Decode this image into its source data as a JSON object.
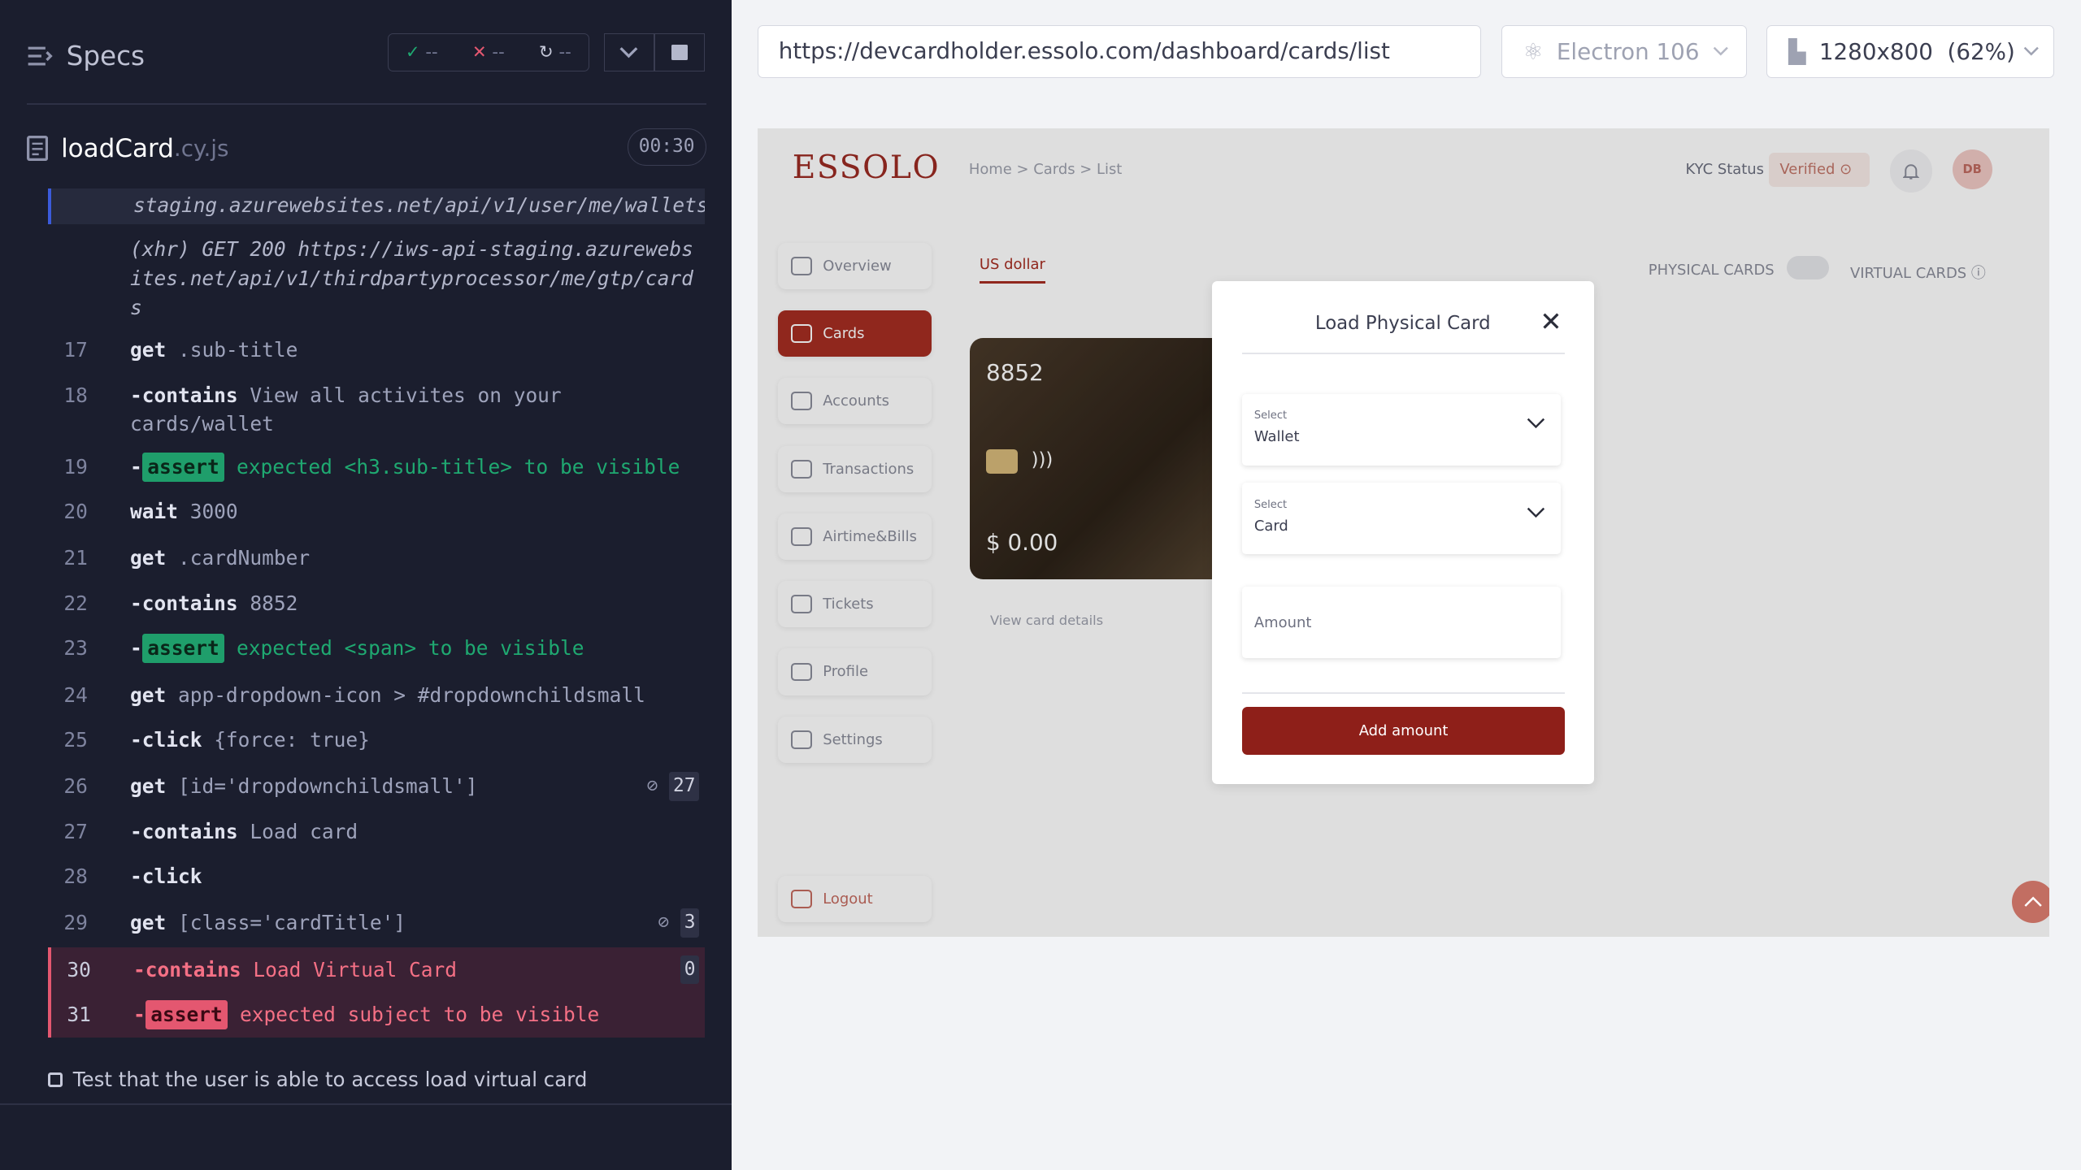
{
  "runner": {
    "specs_title": "Specs",
    "stats": {
      "passed": "--",
      "failed": "--",
      "pending": "--"
    },
    "file_name": "loadCard",
    "file_ext": ".cy.js",
    "timer": "00:30",
    "commands": [
      {
        "num": "",
        "text": "staging.azurewebsites.net/api/v1/user/me/wallets"
      },
      {
        "num": "",
        "text": "(xhr) GET 200 https://iws-api-staging.azurewebsites.net/api/v1/thirdpartyprocessor/me/gtp/cards"
      },
      {
        "num": "17",
        "name": "get",
        "arg": ".sub-title"
      },
      {
        "num": "18",
        "name": "-contains",
        "arg": "View all activites on your cards/wallet"
      },
      {
        "num": "19",
        "name": "assert",
        "arg": "expected <h3.sub-title> to be visible"
      },
      {
        "num": "20",
        "name": "wait",
        "arg": "3000"
      },
      {
        "num": "21",
        "name": "get",
        "arg": ".cardNumber"
      },
      {
        "num": "22",
        "name": "-contains",
        "arg": "8852"
      },
      {
        "num": "23",
        "name": "assert",
        "arg": "expected <span> to be visible"
      },
      {
        "num": "24",
        "name": "get",
        "arg": "app-dropdown-icon > #dropdownchildsmall"
      },
      {
        "num": "25",
        "name": "-click",
        "arg": "{force: true}"
      },
      {
        "num": "26",
        "name": "get",
        "arg": "[id='dropdownchildsmall']",
        "count": "27"
      },
      {
        "num": "27",
        "name": "-contains",
        "arg": "Load card"
      },
      {
        "num": "28",
        "name": "-click",
        "arg": ""
      },
      {
        "num": "29",
        "name": "get",
        "arg": "[class='cardTitle']",
        "count": "3"
      },
      {
        "num": "30",
        "name": "-contains",
        "arg": "Load Virtual Card",
        "count": "0"
      },
      {
        "num": "31",
        "name": "assert",
        "arg": "expected subject to be visible"
      }
    ],
    "test_title": "Test that the user is able to access load virtual card"
  },
  "toolbar": {
    "url": "https://devcardholder.essolo.com/dashboard/cards/list",
    "browser": "Electron 106",
    "viewport": "1280x800",
    "viewport_scale": "(62%)"
  },
  "app": {
    "logo": "ESSOLO",
    "breadcrumb": "Home > Cards > List",
    "kyc_label": "KYC Status",
    "kyc_value": "Verified",
    "avatar": "DB",
    "nav": [
      "Overview",
      "Cards",
      "Accounts",
      "Transactions",
      "Airtime&Bills",
      "Tickets",
      "Profile",
      "Settings"
    ],
    "logout": "Logout",
    "tab": "US dollar",
    "physical_cards": "PHYSICAL CARDS",
    "virtual_cards": "VIRTUAL CARDS",
    "card_number": "8852",
    "card_amount": "$ 0.00",
    "view_card_details": "View card details"
  },
  "modal": {
    "title": "Load Physical Card",
    "wallet_label": "Select",
    "wallet_value": "Wallet",
    "card_label": "Select",
    "card_value": "Card",
    "amount_placeholder": "Amount",
    "submit": "Add amount"
  },
  "colors": {
    "accent": "#8e1f19",
    "fail": "#e45770",
    "pass": "#1f9e6b"
  }
}
